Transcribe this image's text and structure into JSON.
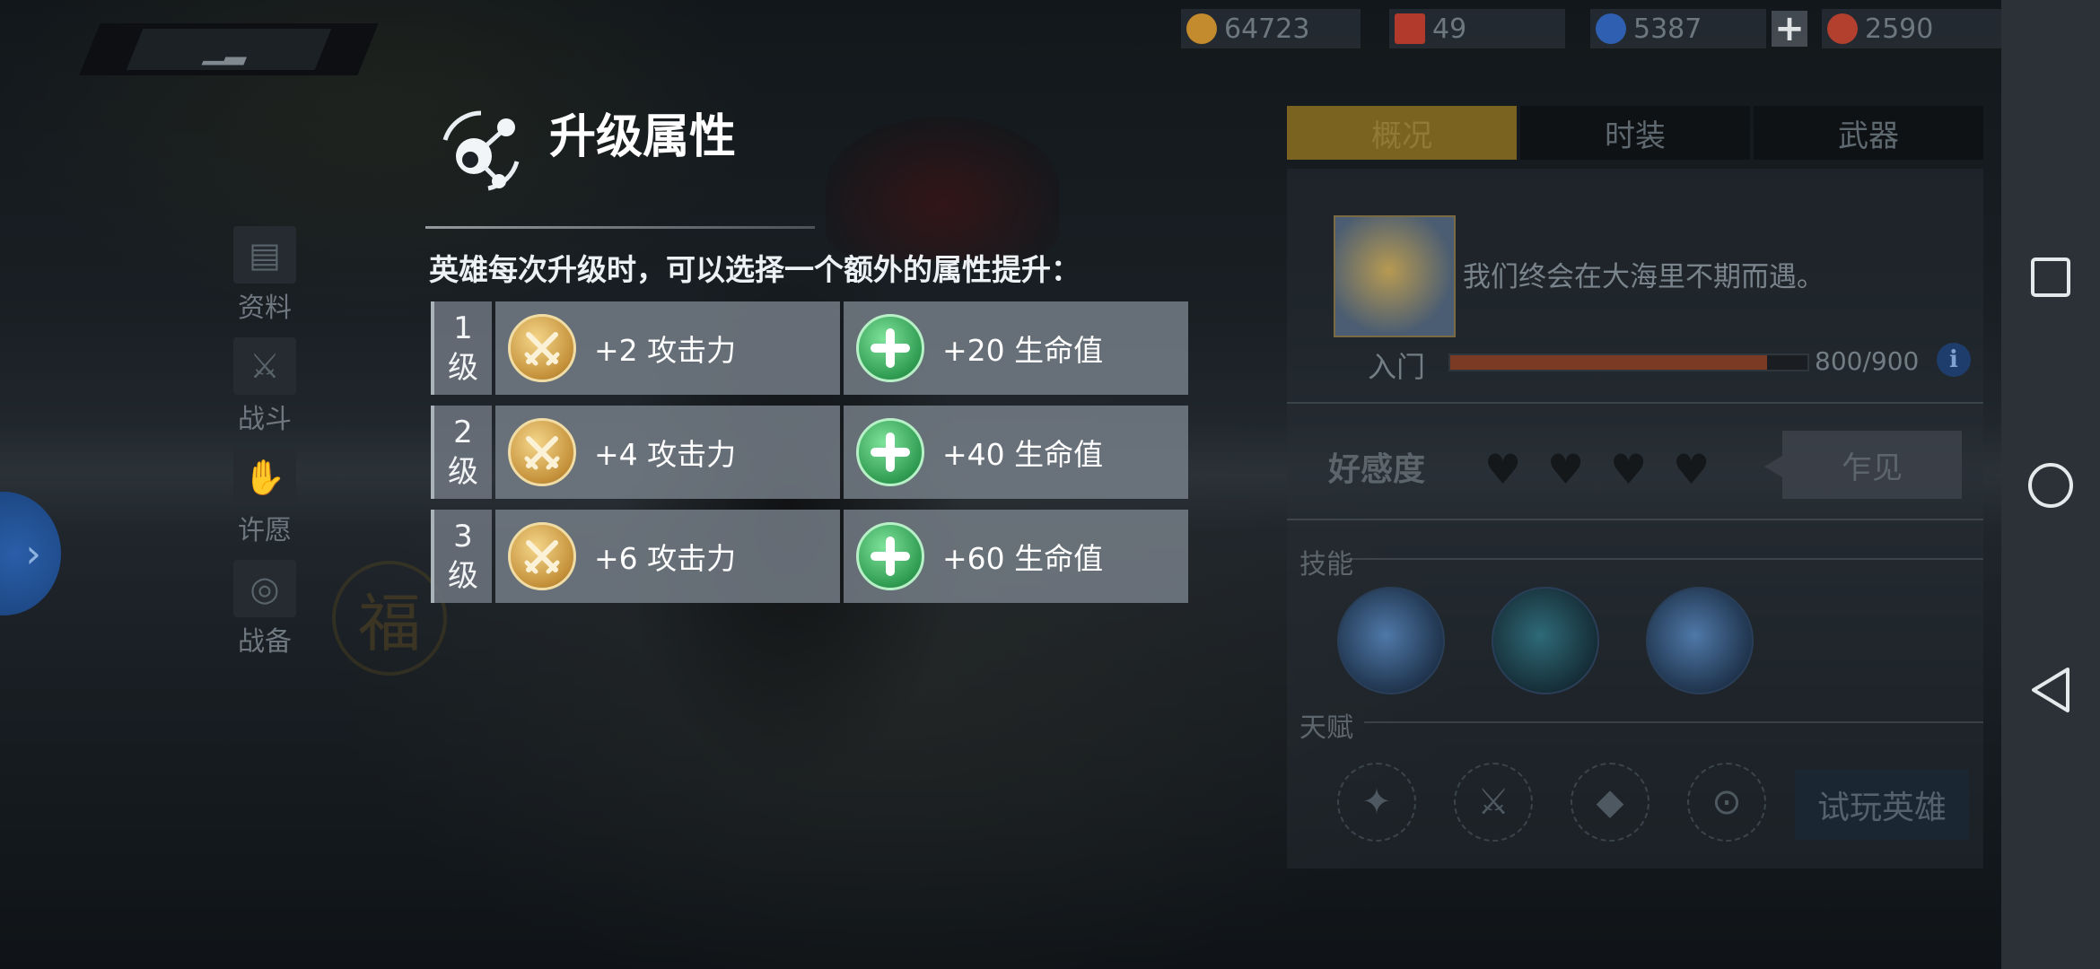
{
  "currency": [
    {
      "icon": "gold-coin-icon",
      "value": "64723",
      "color": "#c48a2e"
    },
    {
      "icon": "stamina-flag-icon",
      "value": "49",
      "color": "#b23a2c"
    },
    {
      "icon": "blue-gem-icon",
      "value": "5387",
      "color": "#2f5fb0"
    },
    {
      "icon": "red-crystal-icon",
      "value": "2590",
      "color": "#b3402e"
    }
  ],
  "currency_plus": "+",
  "side_menu": [
    {
      "label": "资料",
      "icon": "profile-card-icon"
    },
    {
      "label": "战斗",
      "icon": "combat-icon"
    },
    {
      "label": "许愿",
      "icon": "wish-icon"
    },
    {
      "label": "战备",
      "icon": "equipment-icon"
    }
  ],
  "background": {
    "emblem_char": "福"
  },
  "right_panel": {
    "tabs": [
      "概况",
      "时装",
      "武器"
    ],
    "active_tab": 0,
    "quote": "我们终会在大海里不期而遇。",
    "level_label": "入门",
    "exp_text": "800/900",
    "exp_fraction": 0.888,
    "info_icon": "i",
    "favor_label": "好感度",
    "hearts": 4,
    "meet_button": "乍见",
    "skills_label": "技能",
    "talent_label": "天赋",
    "trial_button": "试玩英雄"
  },
  "popup": {
    "title": "升级属性",
    "description": "英雄每次升级时，可以选择一个额外的属性提升：",
    "rows": [
      {
        "level_num": "1",
        "level_unit": "级",
        "attack": "+2 攻击力",
        "hp": "+20 生命值"
      },
      {
        "level_num": "2",
        "level_unit": "级",
        "attack": "+4 攻击力",
        "hp": "+40 生命值"
      },
      {
        "level_num": "3",
        "level_unit": "级",
        "attack": "+6 攻击力",
        "hp": "+60 生命值"
      }
    ]
  },
  "colors": {
    "accent_gold": "#7a6320",
    "attack_coin": "#c5913a",
    "hp_coin": "#2f9c52"
  }
}
